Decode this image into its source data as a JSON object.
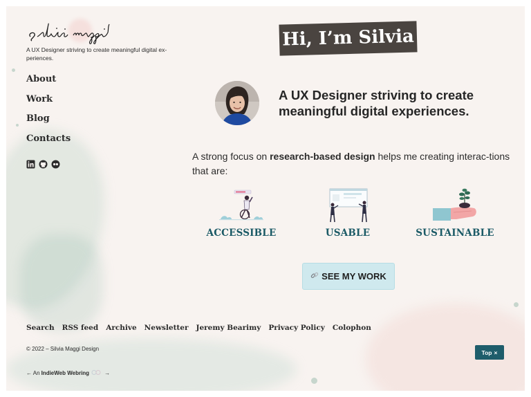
{
  "site": {
    "logo_text": "silvia maggi",
    "tagline": "A UX Designer striving to create meaningful digital ex-periences."
  },
  "nav": {
    "items": [
      {
        "label": "About"
      },
      {
        "label": "Work"
      },
      {
        "label": "Blog"
      },
      {
        "label": "Contacts"
      }
    ]
  },
  "social": {
    "icons": [
      "linkedin-icon",
      "github-icon",
      "flickr-icon"
    ]
  },
  "hero": {
    "title": "Hi, I’m Silvia",
    "headline": "A UX Designer striving to create meaningful digital experiences.",
    "intro_before": "A strong focus on ",
    "intro_bold": "research-based design",
    "intro_after": " helps me creating interac-tions that are:"
  },
  "features": [
    {
      "label": "ACCESSIBLE"
    },
    {
      "label": "USABLE"
    },
    {
      "label": "SUSTAINABLE"
    }
  ],
  "cta": {
    "icon": "link-icon",
    "label": "SEE MY WORK"
  },
  "footer": {
    "links": [
      {
        "label": "Search"
      },
      {
        "label": "RSS feed"
      },
      {
        "label": "Archive"
      },
      {
        "label": "Newsletter"
      },
      {
        "label": "Jeremy Bearimy"
      },
      {
        "label": "Privacy Policy"
      },
      {
        "label": "Colophon"
      }
    ],
    "copyright": "© 2022 – Silvia Maggi Design",
    "webring_prefix": "← An ",
    "webring_name": "IndieWeb Webring",
    "webring_suffix": "→",
    "top_label": "Top",
    "top_icon": "×"
  },
  "colors": {
    "background": "#f8f3f0",
    "accent_dark": "#1e5d6b",
    "feature_text": "#1b5a66",
    "cta_bg": "#cfe9ee",
    "title_bg": "#4a4440"
  }
}
